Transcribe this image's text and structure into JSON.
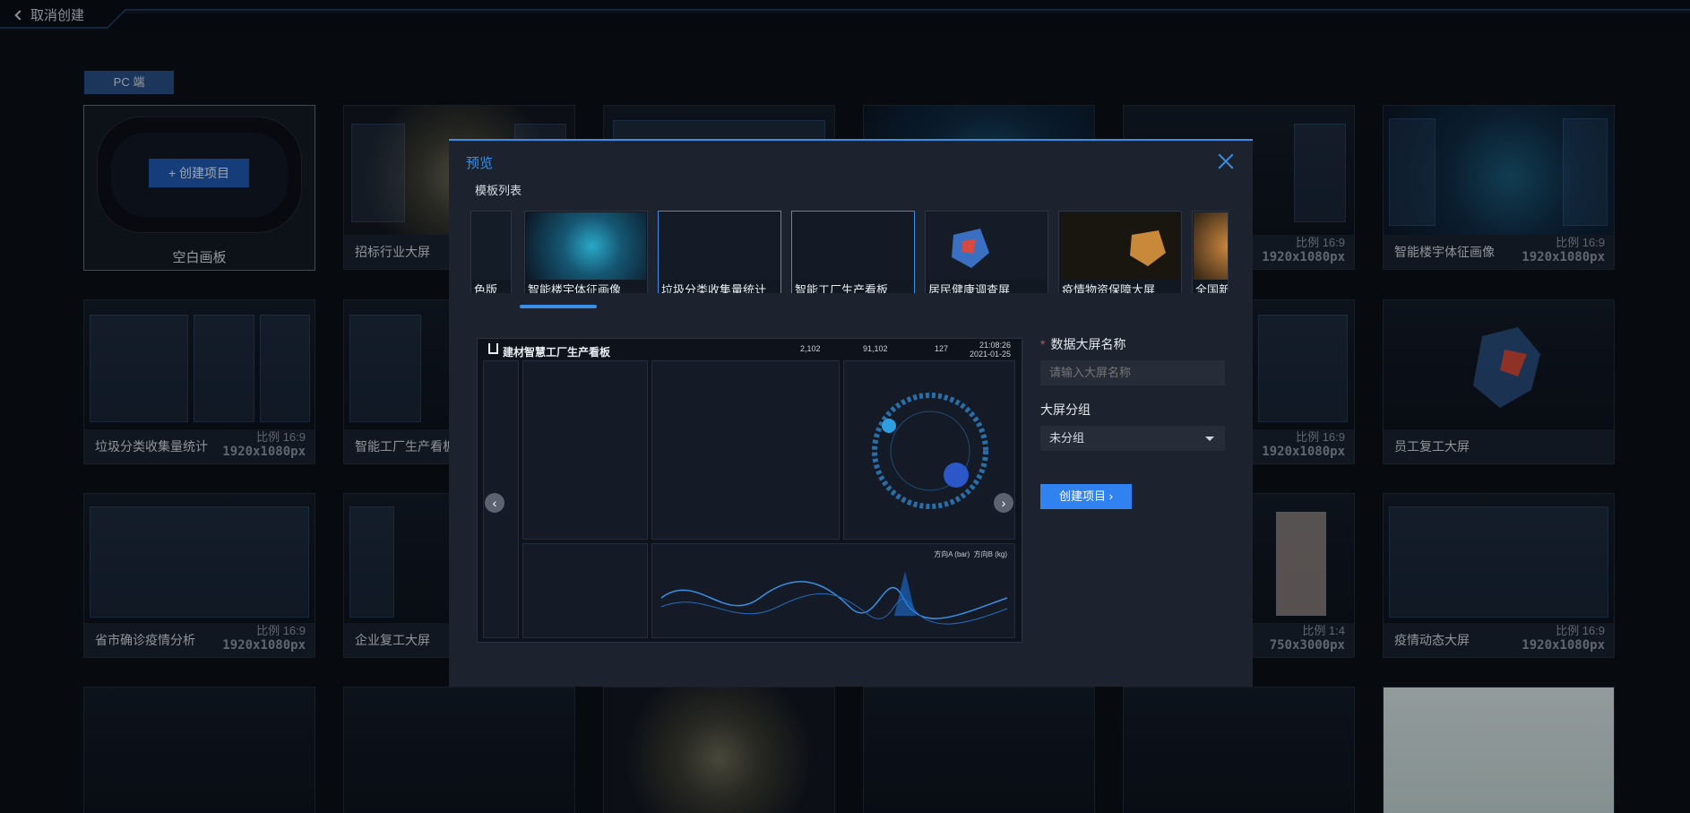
{
  "header": {
    "back_label": "取消创建"
  },
  "platform_tab": "PC 端",
  "blank_card": {
    "button_label": "+ 创建项目",
    "title": "空白画板"
  },
  "cards": [
    {
      "title": "招标行业大屏",
      "ratio": "",
      "size": ""
    },
    {
      "title": "",
      "ratio": "",
      "size": ""
    },
    {
      "title": "",
      "ratio": "",
      "size": ""
    },
    {
      "title": "",
      "ratio": "比例 16:9",
      "size": "1920x1080px"
    },
    {
      "title": "智能楼宇体征画像",
      "ratio": "比例 16:9",
      "size": "1920x1080px"
    },
    {
      "title": "垃圾分类收集量统计",
      "ratio": "比例 16:9",
      "size": "1920x1080px"
    },
    {
      "title": "智能工厂生产看板",
      "ratio": "",
      "size": ""
    },
    {
      "title": "",
      "ratio": "比例 16:9",
      "size": "1920x1080px"
    },
    {
      "title": "员工复工大屏",
      "ratio": "",
      "size": ""
    },
    {
      "title": "省市确诊疫情分析",
      "ratio": "比例 16:9",
      "size": "1920x1080px"
    },
    {
      "title": "企业复工大屏",
      "ratio": "",
      "size": ""
    },
    {
      "title": "",
      "ratio": "比例 1:4",
      "size": "750x3000px"
    },
    {
      "title": "疫情动态大屏",
      "ratio": "比例 16:9",
      "size": "1920x1080px"
    }
  ],
  "modal": {
    "title": "预览",
    "list_label": "模板列表",
    "templates": [
      {
        "label": "色版"
      },
      {
        "label": "智能楼宇体征画像"
      },
      {
        "label": "垃圾分类收集量统计"
      },
      {
        "label": "智能工厂生产看板"
      },
      {
        "label": "居民健康调查屏"
      },
      {
        "label": "疫情物资保障大屏"
      },
      {
        "label": "全国新"
      }
    ],
    "preview": {
      "title": "建材智慧工厂生产看板",
      "stats": [
        "2,102",
        "91,102",
        "127"
      ],
      "time": "21:08:26",
      "date": "2021-01-25",
      "legend": [
        "方向A (bar)",
        "方向B (kg)"
      ]
    },
    "form": {
      "name_label": "数据大屏名称",
      "name_placeholder": "请输入大屏名称",
      "group_label": "大屏分组",
      "group_value": "未分组",
      "submit_label": "创建项目 ›"
    }
  },
  "colors": {
    "accent": "#3a8ee6",
    "button": "#2f82f0",
    "background": "#0b0f17",
    "required": "#e04646"
  }
}
